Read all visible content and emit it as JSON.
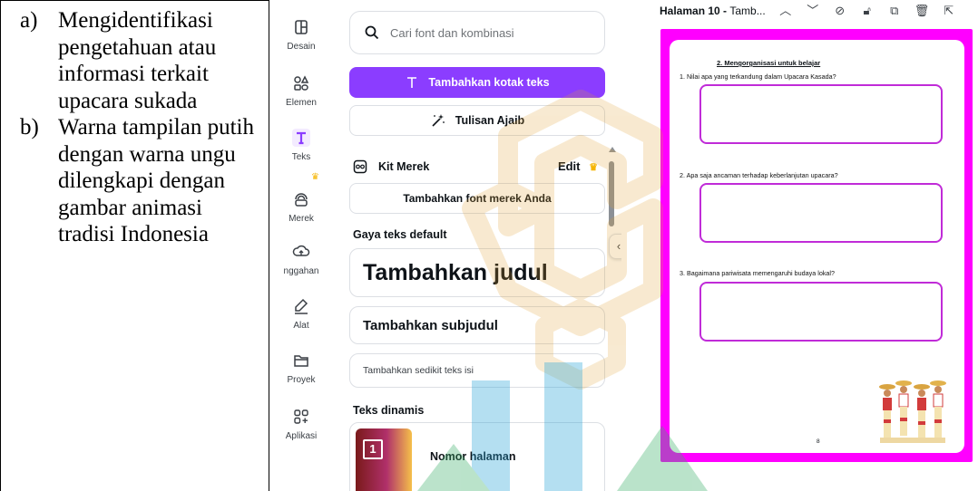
{
  "doc": {
    "items": [
      {
        "marker": "a)",
        "text": "Mengidentifikasi pengetahuan atau informasi terkait upacara sukada"
      },
      {
        "marker": "b)",
        "text": "Warna tampilan putih dengan warna ungu dilengkapi dengan gambar animasi tradisi Indonesia"
      }
    ]
  },
  "rail": {
    "items": [
      {
        "label": "Desain",
        "icon": "layout-icon"
      },
      {
        "label": "Elemen",
        "icon": "shapes-icon"
      },
      {
        "label": "Teks",
        "icon": "text-icon",
        "active": true
      },
      {
        "label": "Merek",
        "icon": "brand-icon"
      },
      {
        "label": "nggahan",
        "icon": "upload-icon"
      },
      {
        "label": "Alat",
        "icon": "draw-icon"
      },
      {
        "label": "Proyek",
        "icon": "folder-icon"
      },
      {
        "label": "Aplikasi",
        "icon": "apps-icon"
      }
    ]
  },
  "panel": {
    "search_placeholder": "Cari font dan kombinasi",
    "add_textbox": "Tambahkan kotak teks",
    "magic_write": "Tulisan Ajaib",
    "brand_kit": "Kit Merek",
    "brand_kit_edit": "Edit",
    "add_brand_font": "Tambahkan font merek Anda",
    "default_styles_heading": "Gaya teks default",
    "add_heading": "Tambahkan judul",
    "add_subheading": "Tambahkan subjudul",
    "add_body": "Tambahkan sedikit teks isi",
    "dynamic_heading": "Teks dinamis",
    "page_number": "Nomor halaman",
    "page_number_thumb": "1"
  },
  "canvas": {
    "page_label": "Halaman 10 - ",
    "page_name": "Tamb...",
    "worksheet_title": "2. Mengorganisasi untuk belajar",
    "questions": [
      "1. Nilai apa yang terkandung dalam Upacara Kasada?",
      "2. Apa saja ancaman terhadap keberlanjutan upacara?",
      "3. Bagaimana pariwisata memengaruhi budaya lokal?"
    ],
    "page_number": "8"
  },
  "colors": {
    "accent": "#8b3dff",
    "page_border": "#ff00ff",
    "answer_box": "#c02bd8",
    "crown": "#f5b400"
  }
}
